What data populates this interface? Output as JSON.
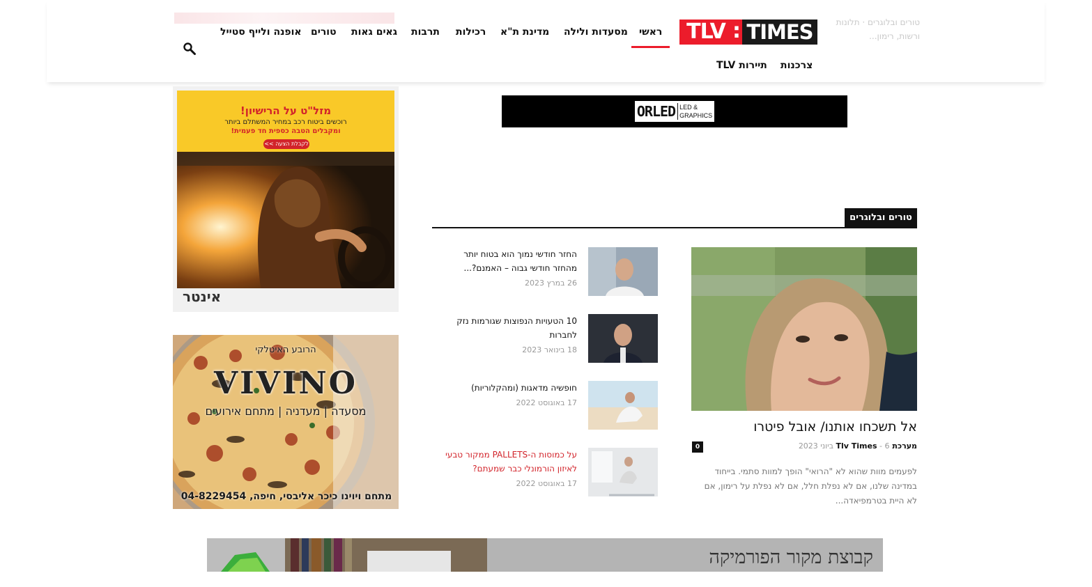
{
  "header": {
    "logo": {
      "part1": "TLV",
      "separator": ":",
      "part2": "TIMES"
    },
    "nav": [
      {
        "label": "ראשי",
        "active": true
      },
      {
        "label": "מסעדות ולילה"
      },
      {
        "label": "מדינת ת\"א"
      },
      {
        "label": "רכילות"
      },
      {
        "label": "תרבות"
      },
      {
        "label": "גאים גאות"
      },
      {
        "label": "טורים"
      },
      {
        "label": "אופנה ולייף סטייל"
      },
      {
        "label": "צרכנות"
      },
      {
        "label": "תיירות TLV"
      }
    ],
    "ghost_text": "טורים ובלוגרים · תלונות ורשות, רימון..."
  },
  "ads": {
    "orled": {
      "main": "ORLED",
      "sub1": "LED &",
      "sub2": "GRAPHICS"
    },
    "car": {
      "headline": "מזל\"ט על הרישיון!",
      "line2": "רוכשים ביטוח רכב במחיר המשתלם ביותר",
      "line3": "ומקבלים הטבה כספית חד פעמית!",
      "button": "לקבלת הצעה >>",
      "logo": "אינטר"
    },
    "pizza": {
      "top": "הרובע האיטלקי",
      "name": "VIVINO",
      "sub": "מסעדה | מעדניה | מתחם אירועים",
      "bottom": "מתחם ויוינו כיכר אליבסי, חיפה, 04-8229454"
    },
    "bottom": {
      "text": "קבוצת מקור הפורמיקה"
    }
  },
  "section": {
    "tag": "טורים ובלוגרים",
    "main": {
      "title": "אל תשכחו אותנו/ אובל פיטרו",
      "author": "מערכת Tlv Times",
      "separator": "-",
      "date": "6 ביוני 2023",
      "comments": "0",
      "excerpt": "לפעמים מוות שהוא לא \"הרואי\" הופך למוות סתמי. בייחוד במדינה שלנו, אם לא נפלת חלל, אם לא נפלת על רימון, אם לא היית בטרמפיאדה..."
    },
    "items": [
      {
        "title": "החזר חודשי נמוך הוא בטוח יותר מהחזר חודשי גבוה – האמנם?...",
        "date": "26 במרץ 2023",
        "red": false
      },
      {
        "title": "10 הטעויות הנפוצות שגורמות נזק לחברות",
        "date": "18 בינואר 2023",
        "red": false
      },
      {
        "title": "חופשיה מדאגות (ומהקלוריות)",
        "date": "17 באוגוסט 2022",
        "red": false
      },
      {
        "title": "על כמוסות ה-PALLETS ממקור טבעי לאיזון הורמונלי כבר שמעתם?",
        "date": "17 באוגוסט 2022",
        "red": true
      }
    ]
  }
}
